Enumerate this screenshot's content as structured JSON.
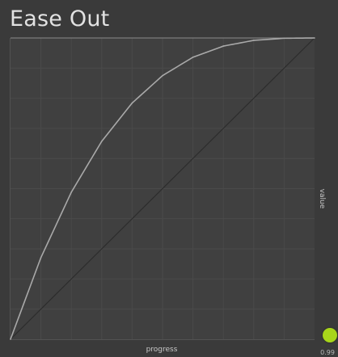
{
  "chart_data": {
    "type": "line",
    "title": "Ease Out",
    "xlabel": "progress",
    "ylabel": "value",
    "xlim": [
      0,
      1
    ],
    "ylim": [
      0,
      1
    ],
    "grid": true,
    "series": [
      {
        "x": [
          0,
          0.1,
          0.2,
          0.3,
          0.4,
          0.5,
          0.6,
          0.7,
          0.8,
          0.9,
          1
        ],
        "values": [
          0,
          0.271,
          0.488,
          0.657,
          0.784,
          0.875,
          0.936,
          0.973,
          0.992,
          0.999,
          1
        ]
      },
      {
        "x": [
          0,
          1
        ],
        "values": [
          0,
          1
        ]
      }
    ],
    "current_value": "0.99"
  },
  "colors": {
    "curve": "#a9a9a9",
    "linear": "#2c2c2c",
    "grid": "#4a4a4a",
    "marker": "#a8d61a"
  }
}
